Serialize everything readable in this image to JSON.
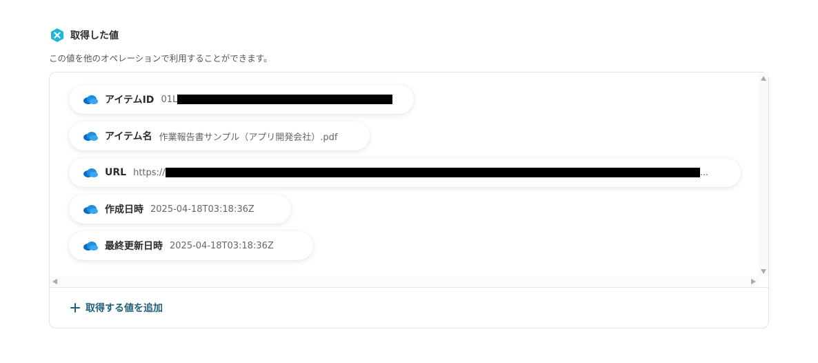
{
  "header": {
    "title": "取得した値",
    "description": "この値を他のオペレーションで利用することができます。",
    "icon": "yoom-badge-icon",
    "accent_color": "#21b6d7"
  },
  "items": [
    {
      "label": "アイテムID",
      "value": "01L",
      "redacted": true,
      "icon": "onedrive-cloud-icon"
    },
    {
      "label": "アイテム名",
      "value": "作業報告書サンプル（アプリ開発会社）.pdf",
      "icon": "onedrive-cloud-icon"
    },
    {
      "label": "URL",
      "value": "https://",
      "redacted": true,
      "truncated": "...",
      "icon": "onedrive-cloud-icon"
    },
    {
      "label": "作成日時",
      "value": "2025-04-18T03:18:36Z",
      "icon": "onedrive-cloud-icon"
    },
    {
      "label": "最終更新日時",
      "value": "2025-04-18T03:18:36Z",
      "icon": "onedrive-cloud-icon"
    }
  ],
  "add_button": {
    "label": "取得する値を追加",
    "color": "#1e5f78"
  }
}
